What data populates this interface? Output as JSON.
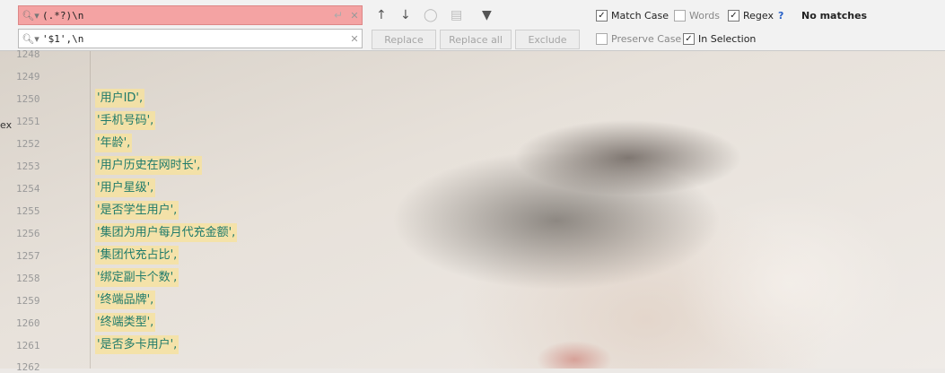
{
  "find": {
    "search_value": "(.*?)\\n",
    "replace_value": "'$1',\\n",
    "icons": [
      "search-icon",
      "enter-icon",
      "clear-icon",
      "arrow-up-icon",
      "arrow-down-icon",
      "find-all-icon",
      "select-all-occurrences-icon",
      "filter-icon"
    ],
    "buttons": {
      "replace": "Replace",
      "replace_all": "Replace all",
      "exclude": "Exclude"
    },
    "options": {
      "match_case": "Match Case",
      "words": "Words",
      "regex": "Regex",
      "preserve_case": "Preserve Case",
      "in_selection": "In Selection"
    },
    "help": "?",
    "status": "No matches"
  },
  "left_stub": "ex",
  "editor": {
    "lines": [
      {
        "num": "1248",
        "text": ""
      },
      {
        "num": "1249",
        "text": ""
      },
      {
        "num": "1250",
        "text": "'用户ID',"
      },
      {
        "num": "1251",
        "text": "'手机号码',"
      },
      {
        "num": "1252",
        "text": "'年龄',"
      },
      {
        "num": "1253",
        "text": "'用户历史在网时长',"
      },
      {
        "num": "1254",
        "text": "'用户星级',"
      },
      {
        "num": "1255",
        "text": "'是否学生用户',"
      },
      {
        "num": "1256",
        "text": "'集团为用户每月代充金额',"
      },
      {
        "num": "1257",
        "text": "'集团代充占比',"
      },
      {
        "num": "1258",
        "text": "'绑定副卡个数',"
      },
      {
        "num": "1259",
        "text": "'终端品牌',"
      },
      {
        "num": "1260",
        "text": "'终端类型',"
      },
      {
        "num": "1261",
        "text": "'是否多卡用户',"
      },
      {
        "num": "1262",
        "text": ""
      }
    ]
  }
}
